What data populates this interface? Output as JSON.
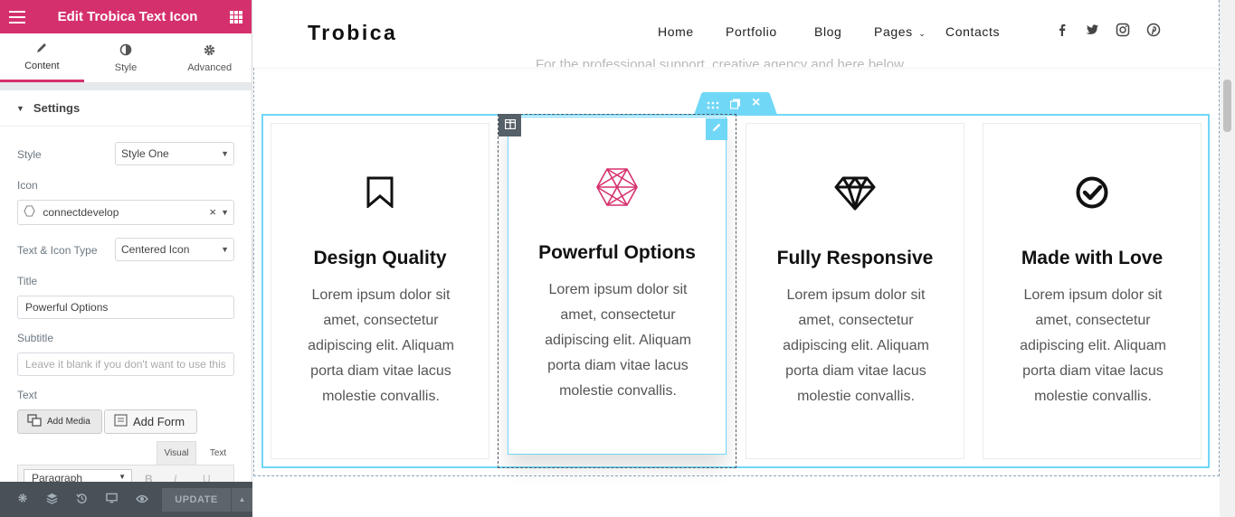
{
  "panel": {
    "header_title": "Edit Trobica Text Icon",
    "tabs": [
      {
        "label": "Content",
        "icon": "pencil-icon"
      },
      {
        "label": "Style",
        "icon": "half-circle-icon"
      },
      {
        "label": "Advanced",
        "icon": "gear-icon"
      }
    ],
    "section_title": "Settings",
    "style_label": "Style",
    "style_value": "Style One",
    "icon_label": "Icon",
    "icon_value": "connectdevelop",
    "text_icon_type_label": "Text & Icon Type",
    "text_icon_type_value": "Centered Icon",
    "title_label": "Title",
    "title_value": "Powerful Options",
    "subtitle_label": "Subtitle",
    "subtitle_placeholder": "Leave it blank if you don't want to use this",
    "text_label": "Text",
    "add_media_label": "Add Media",
    "add_form_label": "Add Form",
    "editor_tab_visual": "Visual",
    "editor_tab_text": "Text",
    "paragraph_value": "Paragraph",
    "format_b": "B",
    "format_i": "I",
    "format_u": "U",
    "update_label": "UPDATE"
  },
  "site": {
    "logo": "Trobica",
    "faded_text": "For the professional support, creative agency and here below.",
    "nav": [
      "Home",
      "Portfolio",
      "Blog",
      "Pages",
      "Contacts"
    ],
    "social": [
      "facebook-icon",
      "twitter-icon",
      "instagram-icon",
      "pinterest-icon"
    ]
  },
  "cards": [
    {
      "title": "Design Quality",
      "text": "Lorem ipsum dolor sit amet, consectetur adipiscing elit. Aliquam porta diam vitae lacus molestie convallis.",
      "icon": "bookmark-icon"
    },
    {
      "title": "Powerful Options",
      "text": "Lorem ipsum dolor sit amet, consectetur adipiscing elit. Aliquam porta diam vitae lacus molestie convallis.",
      "icon": "connectdevelop-icon"
    },
    {
      "title": "Fully Responsive",
      "text": "Lorem ipsum dolor sit amet, consectetur adipiscing elit. Aliquam porta diam vitae lacus molestie convallis.",
      "icon": "diamond-icon"
    },
    {
      "title": "Made with Love",
      "text": "Lorem ipsum dolor sit amet, consectetur adipiscing elit. Aliquam porta diam vitae lacus molestie convallis.",
      "icon": "check-circle-icon"
    }
  ],
  "colors": {
    "brand": "#d5306e",
    "editor_outline": "#71d7f7",
    "footer": "#495157"
  }
}
